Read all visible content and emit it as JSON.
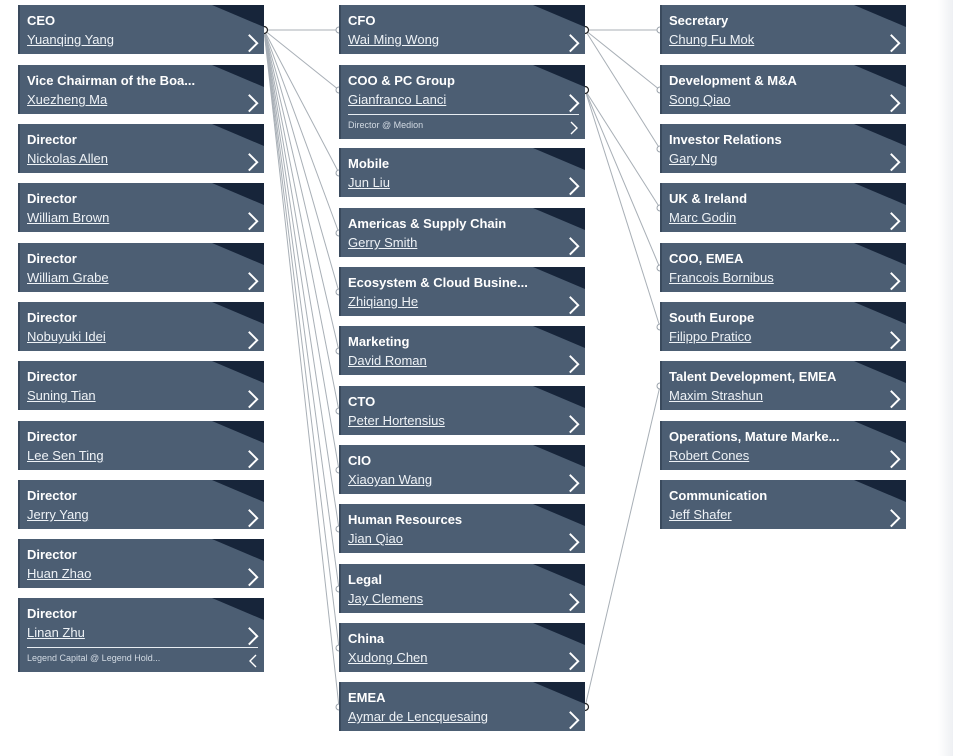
{
  "colors": {
    "card_bg": "#4c5e73",
    "card_corner": "#17253a",
    "connector": "#a8afb6"
  },
  "icons": {
    "open": "chevron-right-icon",
    "collapse": "chevron-left-icon"
  },
  "nodes": [
    {
      "id": "ceo",
      "title": "CEO",
      "name": "Yuanqing Yang"
    },
    {
      "id": "vice-chairman",
      "title": "Vice Chairman of the Boa...",
      "name": "Xuezheng Ma"
    },
    {
      "id": "director-allen",
      "title": "Director",
      "name": "Nickolas Allen"
    },
    {
      "id": "director-brown",
      "title": "Director",
      "name": "William Brown"
    },
    {
      "id": "director-grabe",
      "title": "Director",
      "name": "William Grabe"
    },
    {
      "id": "director-idei",
      "title": "Director",
      "name": "Nobuyuki Idei"
    },
    {
      "id": "director-tian",
      "title": "Director",
      "name": "Suning Tian"
    },
    {
      "id": "director-ting",
      "title": "Director",
      "name": "Lee Sen Ting"
    },
    {
      "id": "director-yang",
      "title": "Director",
      "name": "Jerry Yang"
    },
    {
      "id": "director-zhao",
      "title": "Director",
      "name": "Huan Zhao"
    },
    {
      "id": "director-zhu",
      "title": "Director",
      "name": "Linan Zhu",
      "extra": "Legend Capital @ Legend Hold...",
      "extra_icon": "collapse"
    },
    {
      "id": "cfo",
      "title": "CFO",
      "name": "Wai Ming Wong"
    },
    {
      "id": "coo-pc",
      "title": "COO & PC Group",
      "name": "Gianfranco Lanci",
      "extra": "Director @ Medion",
      "extra_icon": "open"
    },
    {
      "id": "mobile",
      "title": "Mobile",
      "name": "Jun Liu"
    },
    {
      "id": "americas",
      "title": "Americas & Supply Chain",
      "name": "Gerry Smith"
    },
    {
      "id": "ecosystem",
      "title": "Ecosystem & Cloud Busine...",
      "name": "Zhiqiang He"
    },
    {
      "id": "marketing",
      "title": "Marketing",
      "name": "David Roman"
    },
    {
      "id": "cto",
      "title": "CTO",
      "name": "Peter Hortensius"
    },
    {
      "id": "cio",
      "title": "CIO",
      "name": "Xiaoyan Wang"
    },
    {
      "id": "hr",
      "title": "Human Resources",
      "name": "Jian Qiao"
    },
    {
      "id": "legal",
      "title": "Legal",
      "name": "Jay Clemens"
    },
    {
      "id": "china",
      "title": "China",
      "name": "Xudong Chen"
    },
    {
      "id": "emea",
      "title": "EMEA",
      "name": "Aymar de Lencquesaing"
    },
    {
      "id": "secretary",
      "title": "Secretary",
      "name": "Chung Fu Mok"
    },
    {
      "id": "development",
      "title": "Development & M&A",
      "name": "Song Qiao"
    },
    {
      "id": "investor",
      "title": "Investor Relations",
      "name": "Gary Ng"
    },
    {
      "id": "uk-ireland",
      "title": "UK & Ireland",
      "name": "Marc Godin"
    },
    {
      "id": "coo-emea",
      "title": "COO, EMEA",
      "name": "Francois Bornibus"
    },
    {
      "id": "south-europe",
      "title": "South Europe",
      "name": "Filippo Pratico"
    },
    {
      "id": "talent",
      "title": "Talent Development, EMEA",
      "name": "Maxim Strashun"
    },
    {
      "id": "operations",
      "title": "Operations, Mature Marke...",
      "name": "Robert Cones"
    },
    {
      "id": "communication",
      "title": "Communication",
      "name": "Jeff Shafer"
    }
  ],
  "edges": [
    [
      "ceo",
      "cfo"
    ],
    [
      "ceo",
      "coo-pc"
    ],
    [
      "ceo",
      "mobile"
    ],
    [
      "ceo",
      "americas"
    ],
    [
      "ceo",
      "ecosystem"
    ],
    [
      "ceo",
      "marketing"
    ],
    [
      "ceo",
      "cto"
    ],
    [
      "ceo",
      "cio"
    ],
    [
      "ceo",
      "hr"
    ],
    [
      "ceo",
      "legal"
    ],
    [
      "ceo",
      "china"
    ],
    [
      "ceo",
      "emea"
    ],
    [
      "cfo",
      "secretary"
    ],
    [
      "cfo",
      "development"
    ],
    [
      "cfo",
      "investor"
    ],
    [
      "coo-pc",
      "uk-ireland"
    ],
    [
      "coo-pc",
      "coo-emea"
    ],
    [
      "coo-pc",
      "south-europe"
    ],
    [
      "emea",
      "talent"
    ]
  ]
}
